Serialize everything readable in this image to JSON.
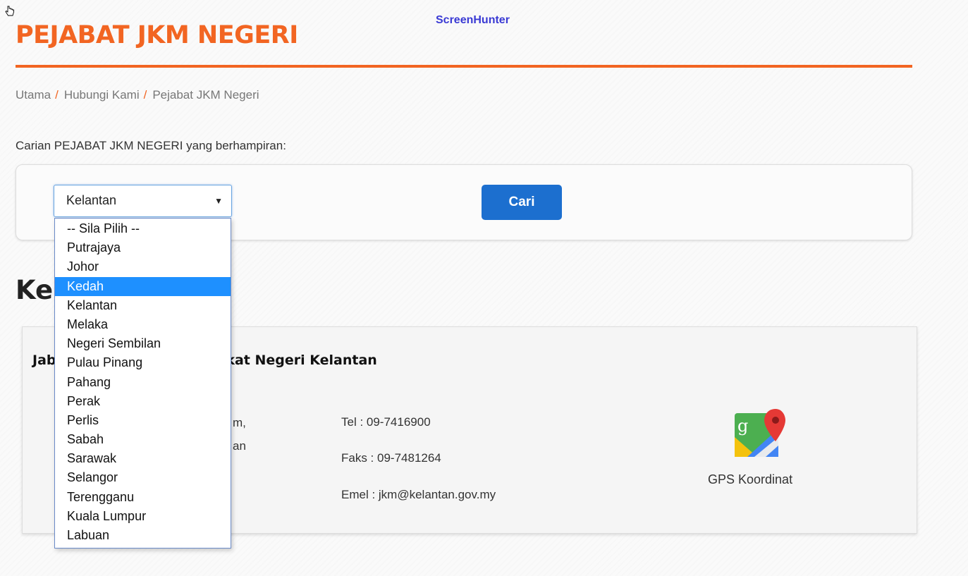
{
  "watermark": "ScreenHunter",
  "page_title": "PEJABAT JKM NEGERI",
  "breadcrumb": {
    "items": [
      "Utama",
      "Hubungi Kami",
      "Pejabat JKM Negeri"
    ],
    "separator": "/"
  },
  "search": {
    "label": "Carian PEJABAT JKM NEGERI yang berhampiran:",
    "selected_state": "Kelantan",
    "button_label": "Cari",
    "options": [
      "-- Sila Pilih --",
      "Putrajaya",
      "Johor",
      "Kedah",
      "Kelantan",
      "Melaka",
      "Negeri Sembilan",
      "Pulau Pinang",
      "Pahang",
      "Perak",
      "Perlis",
      "Sabah",
      "Sarawak",
      "Selangor",
      "Terengganu",
      "Kuala Lumpur",
      "Labuan"
    ],
    "highlighted_option": "Kedah"
  },
  "result": {
    "heading_visible": "Kel",
    "office_name_left": "Jab",
    "office_name_right": "akat Negeri Kelantan",
    "address_fragments": [
      "m,",
      "an"
    ],
    "tel": "Tel : 09-7416900",
    "fax": "Faks : 09-7481264",
    "email": "Emel : jkm@kelantan.gov.my",
    "gps_label": "GPS Koordinat"
  },
  "colors": {
    "accent": "#f26522",
    "button": "#1c6fcf",
    "highlight": "#1e90ff"
  }
}
